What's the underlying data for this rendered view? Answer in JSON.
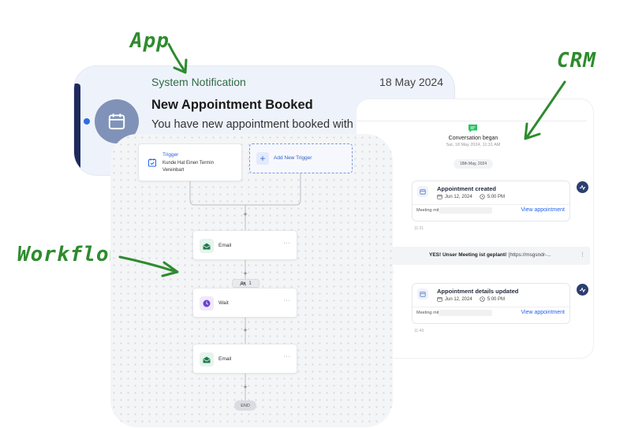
{
  "annotations": {
    "app": "App",
    "crm": "CRM",
    "workflow": "Workflow"
  },
  "app_notification": {
    "source": "System Notification",
    "date": "18 May 2024",
    "title": "New Appointment Booked",
    "body": "You have new appointment booked with"
  },
  "crm": {
    "conversation": {
      "title": "Conversation began",
      "time": "Sat, 18 May 2024, 11:31 AM"
    },
    "date_divider": "18th May, 2024",
    "events": [
      {
        "title": "Appointment created",
        "date": "Jun 12, 2024",
        "time": "5:00 PM",
        "meeting_label": "Meeting mit",
        "link": "View appointment",
        "timestamp": "11:31"
      },
      {
        "title": "Appointment details updated",
        "date": "Jun 12, 2024",
        "time": "5:00 PM",
        "meeting_label": "Meeting mit",
        "link": "View appointment",
        "timestamp": "11:49"
      }
    ],
    "message": {
      "prefix": "e",
      "text": "YES! Unser Meeting ist geplant!",
      "separator": "-",
      "link": "[https://msgsndr-...",
      "more": "⋮",
      "sub": "d"
    }
  },
  "workflow": {
    "trigger": {
      "title": "Trigger",
      "description": "Kunde Hat Einen Termin Vereinbart"
    },
    "add_trigger": "Add New Trigger",
    "nodes": [
      {
        "label": "Email",
        "more": "···"
      },
      {
        "label": "Wait",
        "more": "···"
      },
      {
        "label": "Email",
        "more": "···"
      }
    ],
    "plus": "+",
    "badge_count": "1",
    "end_label": "END"
  },
  "colors": {
    "annotation": "#2e8b2e",
    "link": "#2563eb",
    "app_bg": "#eef3fb",
    "avatar": "#8092b8",
    "email_icon": "#1e7a4e",
    "wait_icon": "#6d3fd6"
  }
}
